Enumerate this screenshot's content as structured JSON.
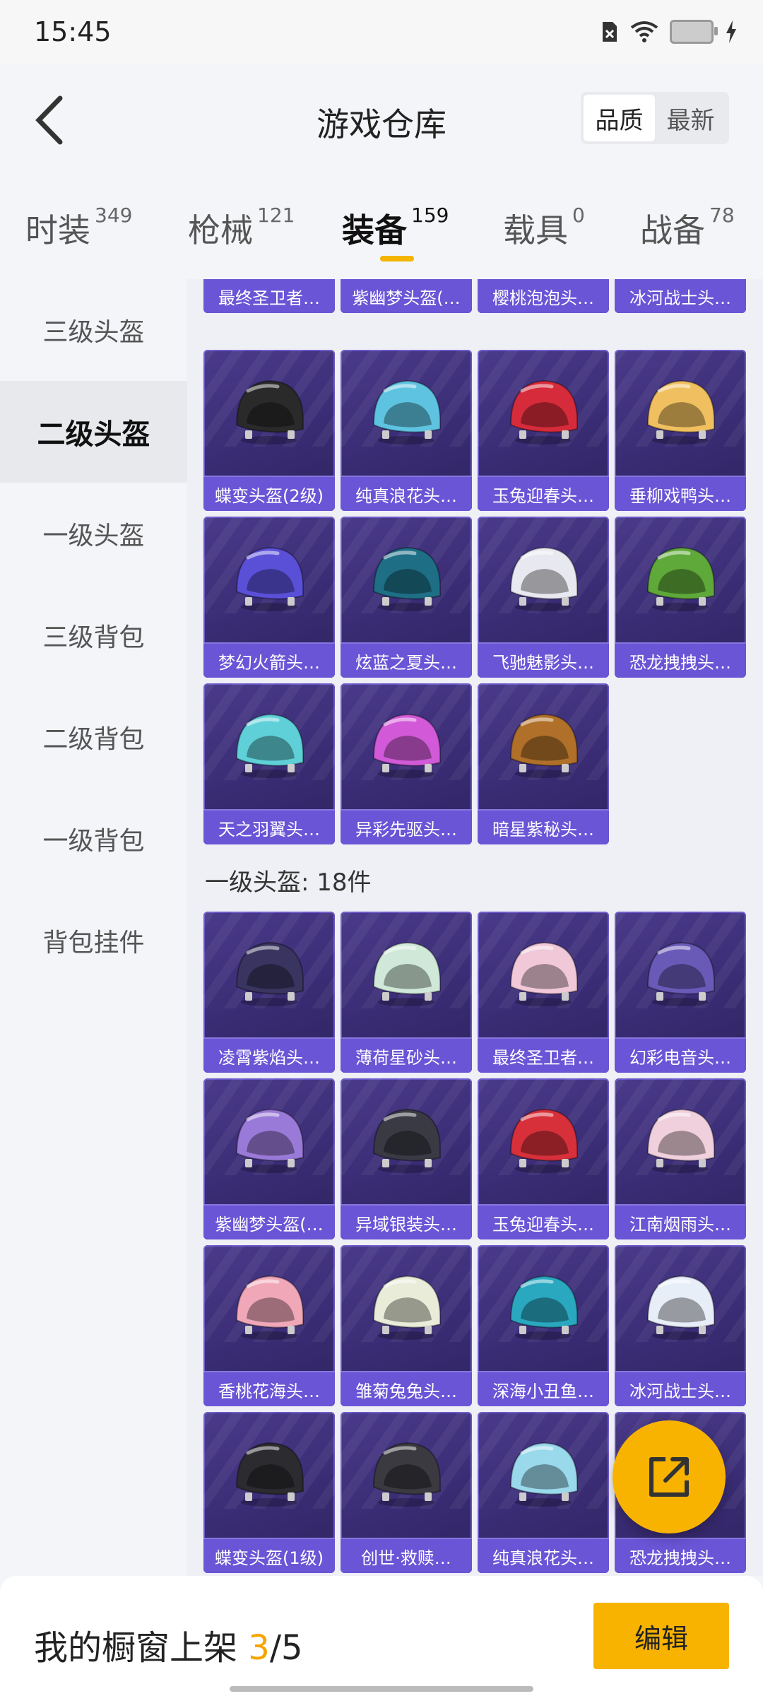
{
  "status_bar": {
    "time": "15:45"
  },
  "header": {
    "title": "游戏仓库",
    "sort_options": [
      "品质",
      "最新"
    ]
  },
  "tabs": [
    {
      "label": "时装",
      "count": "349"
    },
    {
      "label": "枪械",
      "count": "121"
    },
    {
      "label": "装备",
      "count": "159"
    },
    {
      "label": "载具",
      "count": "0"
    },
    {
      "label": "战备",
      "count": "78"
    }
  ],
  "sidebar": [
    "三级头盔",
    "二级头盔",
    "一级头盔",
    "三级背包",
    "二级背包",
    "一级背包",
    "背包挂件"
  ],
  "level3_tail": [
    "最终圣卫者…",
    "紫幽梦头盔(…",
    "樱桃泡泡头…",
    "冰河战士头…"
  ],
  "level2_items": [
    {
      "name": "蝶变头盔(2级)",
      "color": "#2a2a2a"
    },
    {
      "name": "纯真浪花头…",
      "color": "#5ec3e0"
    },
    {
      "name": "玉兔迎春头…",
      "color": "#d62b3a"
    },
    {
      "name": "垂柳戏鸭头…",
      "color": "#f0c060"
    },
    {
      "name": "梦幻火箭头…",
      "color": "#5a50d8"
    },
    {
      "name": "炫蓝之夏头…",
      "color": "#1e6f86"
    },
    {
      "name": "飞驰魅影头…",
      "color": "#e8e8f0"
    },
    {
      "name": "恐龙拽拽头…",
      "color": "#5fa83a"
    },
    {
      "name": "天之羽翼头…",
      "color": "#5fd0d8"
    },
    {
      "name": "异彩先驱头…",
      "color": "#d25ad8"
    },
    {
      "name": "暗星紫秘头…",
      "color": "#b0702a"
    }
  ],
  "level1_section": {
    "title": "一级头盔: 18件"
  },
  "level1_items": [
    {
      "name": "凌霄紫焰头…",
      "color": "#3a3560"
    },
    {
      "name": "薄荷星砂头…",
      "color": "#cfe8d8"
    },
    {
      "name": "最终圣卫者…",
      "color": "#f0c8d8"
    },
    {
      "name": "幻彩电音头…",
      "color": "#6a5ab8"
    },
    {
      "name": "紫幽梦头盔(…",
      "color": "#9a7ad8"
    },
    {
      "name": "异域银装头…",
      "color": "#3a3a44"
    },
    {
      "name": "玉兔迎春头…",
      "color": "#d8303a"
    },
    {
      "name": "江南烟雨头…",
      "color": "#f0d0dc"
    },
    {
      "name": "香桃花海头…",
      "color": "#f0a8b8"
    },
    {
      "name": "雏菊兔兔头…",
      "color": "#e8ecd8"
    },
    {
      "name": "深海小丑鱼…",
      "color": "#2aa8c0"
    },
    {
      "name": "冰河战士头…",
      "color": "#e8eef8"
    },
    {
      "name": "蝶变头盔(1级)",
      "color": "#2c2c30"
    },
    {
      "name": "创世·救赎…",
      "color": "#3a3a40"
    },
    {
      "name": "纯真浪花头…",
      "color": "#9ad8ec"
    },
    {
      "name": "恐龙拽拽头…",
      "color": "#6ab04a"
    }
  ],
  "bottom": {
    "prefix": "我的橱窗上架 ",
    "current": "3",
    "suffix": "/5",
    "edit_label": "编辑"
  },
  "accent": "#f7b300"
}
